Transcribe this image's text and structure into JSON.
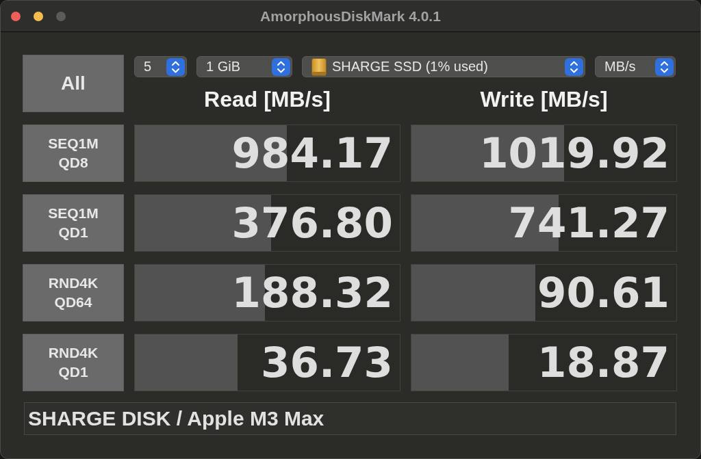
{
  "window": {
    "title": "AmorphousDiskMark 4.0.1",
    "controls": [
      {
        "kind": "close",
        "disabled": false
      },
      {
        "kind": "minimize",
        "disabled": false
      },
      {
        "kind": "zoom",
        "disabled": true
      }
    ]
  },
  "toolbar": {
    "all_button": "All",
    "selects": [
      {
        "kind": "count",
        "value": "5"
      },
      {
        "kind": "size",
        "value": "1 GiB"
      },
      {
        "kind": "drive",
        "value": "SHARGE SSD (1% used)"
      },
      {
        "kind": "unit",
        "value": "MB/s"
      }
    ]
  },
  "columns": [
    "Read [MB/s]",
    "Write [MB/s]"
  ],
  "tests": [
    {
      "label_lines": [
        "SEQ1M",
        "QD8"
      ],
      "read": {
        "value": "984.17",
        "level": 0.573
      },
      "write": {
        "value": "1019.92",
        "level": 0.576
      }
    },
    {
      "label_lines": [
        "SEQ1M",
        "QD1"
      ],
      "read": {
        "value": "376.80",
        "level": 0.514
      },
      "write": {
        "value": "741.27",
        "level": 0.555
      }
    },
    {
      "label_lines": [
        "RND4K",
        "QD64"
      ],
      "read": {
        "value": "188.32",
        "level": 0.49
      },
      "write": {
        "value": "90.61",
        "level": 0.468
      }
    },
    {
      "label_lines": [
        "RND4K",
        "QD1"
      ],
      "read": {
        "value": "36.73",
        "level": 0.388
      },
      "write": {
        "value": "18.87",
        "level": 0.368
      }
    }
  ],
  "status": "SHARGE DISK / Apple M3 Max"
}
